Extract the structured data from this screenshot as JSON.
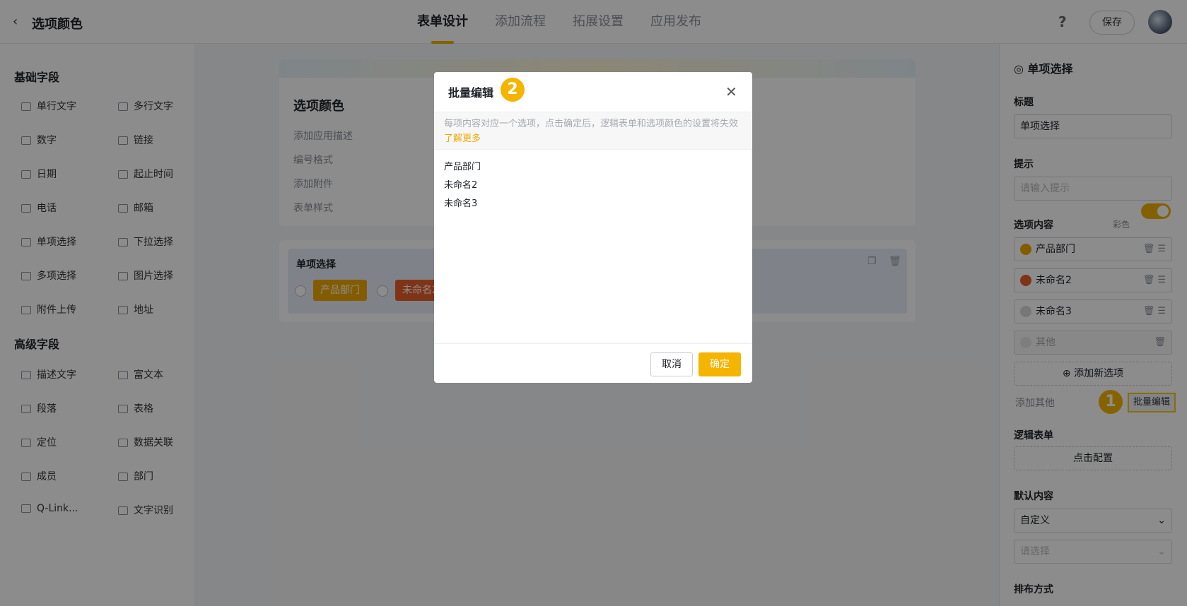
{
  "header": {
    "back_icon": "chevron-left-icon",
    "title": "选项颜色",
    "tabs": [
      {
        "label": "表单设计",
        "active": true
      },
      {
        "label": "添加流程",
        "active": false
      },
      {
        "label": "拓展设置",
        "active": false
      },
      {
        "label": "应用发布",
        "active": false
      }
    ],
    "help_label": "?",
    "save_label": "保存"
  },
  "sidebar": {
    "basic_title": "基础字段",
    "basic_fields": [
      "单行文字",
      "多行文字",
      "数字",
      "链接",
      "日期",
      "起止时间",
      "电话",
      "邮箱",
      "单项选择",
      "下拉选择",
      "多项选择",
      "图片选择",
      "附件上传",
      "地址"
    ],
    "advanced_title": "高级字段",
    "advanced_fields": [
      "描述文字",
      "富文本",
      "段落",
      "表格",
      "定位",
      "数据关联",
      "成员",
      "部门",
      "Q-Link...",
      "文字识别"
    ]
  },
  "canvas": {
    "form_title": "选项颜色",
    "links": [
      "添加应用描述",
      "编号格式",
      "添加附件",
      "表单样式"
    ],
    "field_label": "单项选择",
    "chips": [
      {
        "label": "产品部门",
        "color": "#f0a800"
      },
      {
        "label": "未命名2",
        "color": "#e8602c"
      }
    ]
  },
  "right_panel": {
    "field_type": "单项选择",
    "title_label": "标题",
    "title_value": "单项选择",
    "hint_label": "提示",
    "hint_placeholder": "请输入提示",
    "options_label": "选项内容",
    "color_toggle_label": "彩色",
    "options": [
      {
        "label": "产品部门",
        "color": "#f0a800"
      },
      {
        "label": "未命名2",
        "color": "#e8602c"
      },
      {
        "label": "未命名3",
        "color": "#d9d9d9"
      }
    ],
    "other_label": "其他",
    "add_option_label": "添加新选项",
    "add_other_label": "添加其他",
    "batch_edit_label": "批量编辑",
    "logic_label": "逻辑表单",
    "logic_button": "点击配置",
    "default_label": "默认内容",
    "default_value": "自定义",
    "default_select_placeholder": "请选择",
    "layout_label": "排布方式",
    "badge_1": "1"
  },
  "modal": {
    "title": "批量编辑",
    "badge_2": "2",
    "note": "每项内容对应一个选项，点击确定后，逻辑表单和选项颜色的设置将失效",
    "learn_more": "了解更多",
    "lines": [
      "产品部门",
      "未命名2",
      "未命名3"
    ],
    "cancel_label": "取消",
    "ok_label": "确定"
  }
}
